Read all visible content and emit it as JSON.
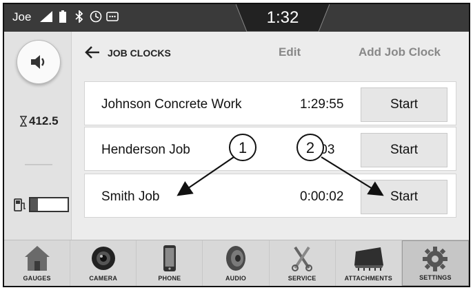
{
  "status": {
    "user": "Joe",
    "time": "1:32",
    "icons": [
      "signal-icon",
      "battery-icon",
      "bluetooth-icon",
      "clock-icon",
      "message-icon"
    ]
  },
  "left_rail": {
    "hours": "412.5",
    "volume_icon": "speaker-icon",
    "fuel_level": 0.2
  },
  "header": {
    "title": "JOB CLOCKS",
    "edit_label": "Edit",
    "add_label": "Add Job Clock"
  },
  "jobs": [
    {
      "name": "Johnson Concrete Work",
      "time": "1:29:55",
      "button": "Start"
    },
    {
      "name": "Henderson Job",
      "time": ":03",
      "button": "Start"
    },
    {
      "name": "Smith Job",
      "time": "0:00:02",
      "button": "Start"
    }
  ],
  "callouts": [
    "1",
    "2"
  ],
  "nav": [
    {
      "label": "GAUGES",
      "icon": "house-icon"
    },
    {
      "label": "CAMERA",
      "icon": "camera-icon"
    },
    {
      "label": "PHONE",
      "icon": "phone-icon"
    },
    {
      "label": "AUDIO",
      "icon": "speaker-icon"
    },
    {
      "label": "SERVICE",
      "icon": "wrench-icon"
    },
    {
      "label": "ATTACHMENTS",
      "icon": "bucket-icon"
    },
    {
      "label": "SETTINGS",
      "icon": "gear-icon"
    }
  ],
  "active_nav": "SETTINGS"
}
